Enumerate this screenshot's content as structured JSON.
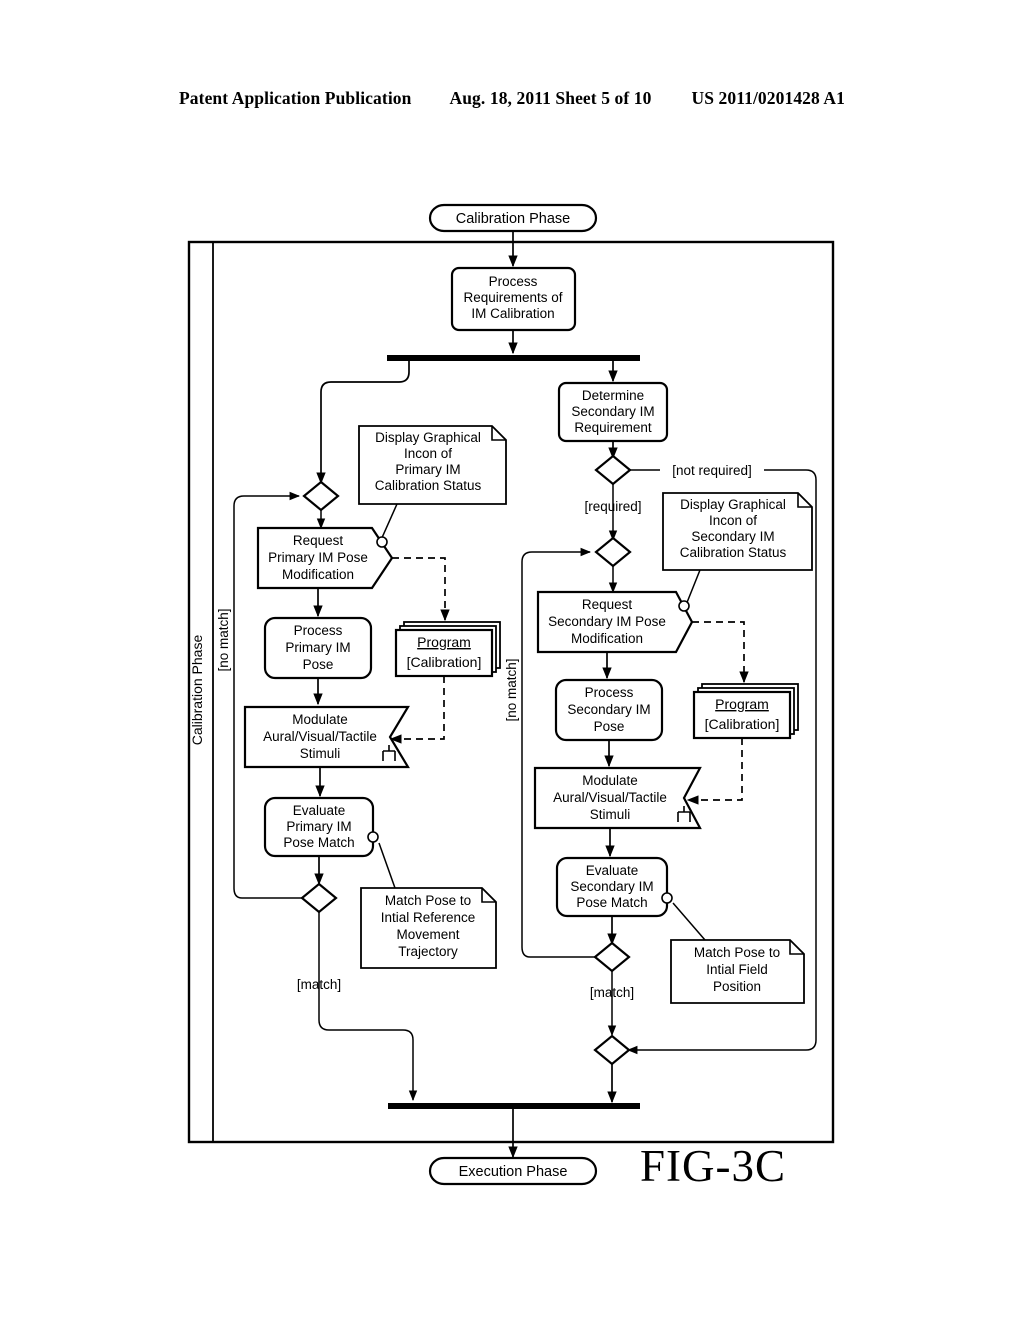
{
  "header": {
    "publication": "Patent Application Publication",
    "date_sheet": "Aug. 18, 2011  Sheet 5 of 10",
    "patent_number": "US 2011/0201428 A1"
  },
  "figure": {
    "label": "FIG-3C"
  },
  "swimlane": {
    "title": "Calibration Phase"
  },
  "terminals": {
    "start": "Calibration Phase",
    "end": "Execution Phase"
  },
  "nodes": {
    "process_requirements": [
      "Process",
      "Requirements  of",
      "IM  Calibration"
    ],
    "determine_secondary": [
      "Determine",
      "Secondary  IM",
      "Requirement"
    ],
    "note_primary_display": [
      "Display  Graphical",
      "Incon  of",
      "Primary  IM",
      "Calibration  Status"
    ],
    "note_secondary_display": [
      "Display  Graphical",
      "Incon  of",
      "Secondary  IM",
      "Calibration  Status"
    ],
    "request_primary": [
      "Request",
      "Primary  IM  Pose",
      "Modification"
    ],
    "request_secondary": [
      "Request",
      "Secondary  IM  Pose",
      "Modification"
    ],
    "process_primary_pose": [
      "Process",
      "Primary  IM",
      "Pose"
    ],
    "process_secondary_pose": [
      "Process",
      "Secondary  IM",
      "Pose"
    ],
    "program_primary": {
      "title": "Program",
      "subtitle": "[Calibration]"
    },
    "program_secondary": {
      "title": "Program",
      "subtitle": "[Calibration]"
    },
    "modulate_primary": [
      "Modulate",
      "Aural/Visual/Tactile",
      "Stimuli"
    ],
    "modulate_secondary": [
      "Modulate",
      "Aural/Visual/Tactile",
      "Stimuli"
    ],
    "evaluate_primary": [
      "Evaluate",
      "Primary  IM",
      "Pose  Match"
    ],
    "evaluate_secondary": [
      "Evaluate",
      "Secondary  IM",
      "Pose  Match"
    ],
    "note_match_primary": [
      "Match  Pose  to",
      "Intial  Reference",
      "Movement",
      "Trajectory"
    ],
    "note_match_secondary": [
      "Match  Pose  to",
      "Intial  Field",
      "Position"
    ]
  },
  "guards": {
    "not_required": "[not  required]",
    "required": "[required]",
    "no_match_primary": "[no  match]",
    "no_match_secondary": "[no  match]",
    "match_primary": "[match]",
    "match_secondary": "[match]"
  },
  "colors": {
    "ink": "#000000",
    "paper": "#ffffff"
  }
}
